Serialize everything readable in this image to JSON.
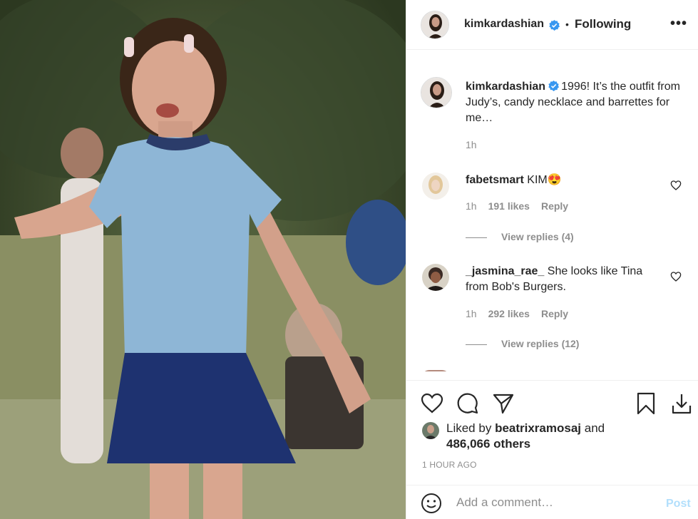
{
  "post": {
    "username": "kimkardashian",
    "separator": "•",
    "follow_status": "Following",
    "more": "•••",
    "caption": "1996! It’s the outfit from Judy’s, candy necklace and barrettes for me…",
    "caption_time": "1h"
  },
  "comments": [
    {
      "username": "fabetsmart",
      "text": "KIM",
      "emoji": "😍",
      "time": "1h",
      "likes": "191 likes",
      "reply": "Reply",
      "view_replies": "View replies (4)"
    },
    {
      "username": "_jasmina_rae_",
      "text": "She looks like Tina from Bob's Burgers.",
      "time": "1h",
      "likes": "292 likes",
      "reply": "Reply",
      "view_replies": "View replies (12)"
    }
  ],
  "liked_by": {
    "prefix": "Liked by",
    "user": "beatrixramosaj",
    "and": "and",
    "others": "486,066 others"
  },
  "timestamp": "1 HOUR AGO",
  "comment_box": {
    "placeholder": "Add a comment…",
    "post_label": "Post"
  },
  "icons": {
    "verified": "verified-badge-icon",
    "heart": "heart-icon",
    "comment": "comment-icon",
    "share": "share-icon",
    "save": "bookmark-icon",
    "download": "download-icon",
    "emoji": "smiley-icon"
  },
  "colors": {
    "verified": "#3897f0",
    "text": "#262626",
    "muted": "#8e8e8e",
    "post_disabled": "#b2dffc"
  }
}
